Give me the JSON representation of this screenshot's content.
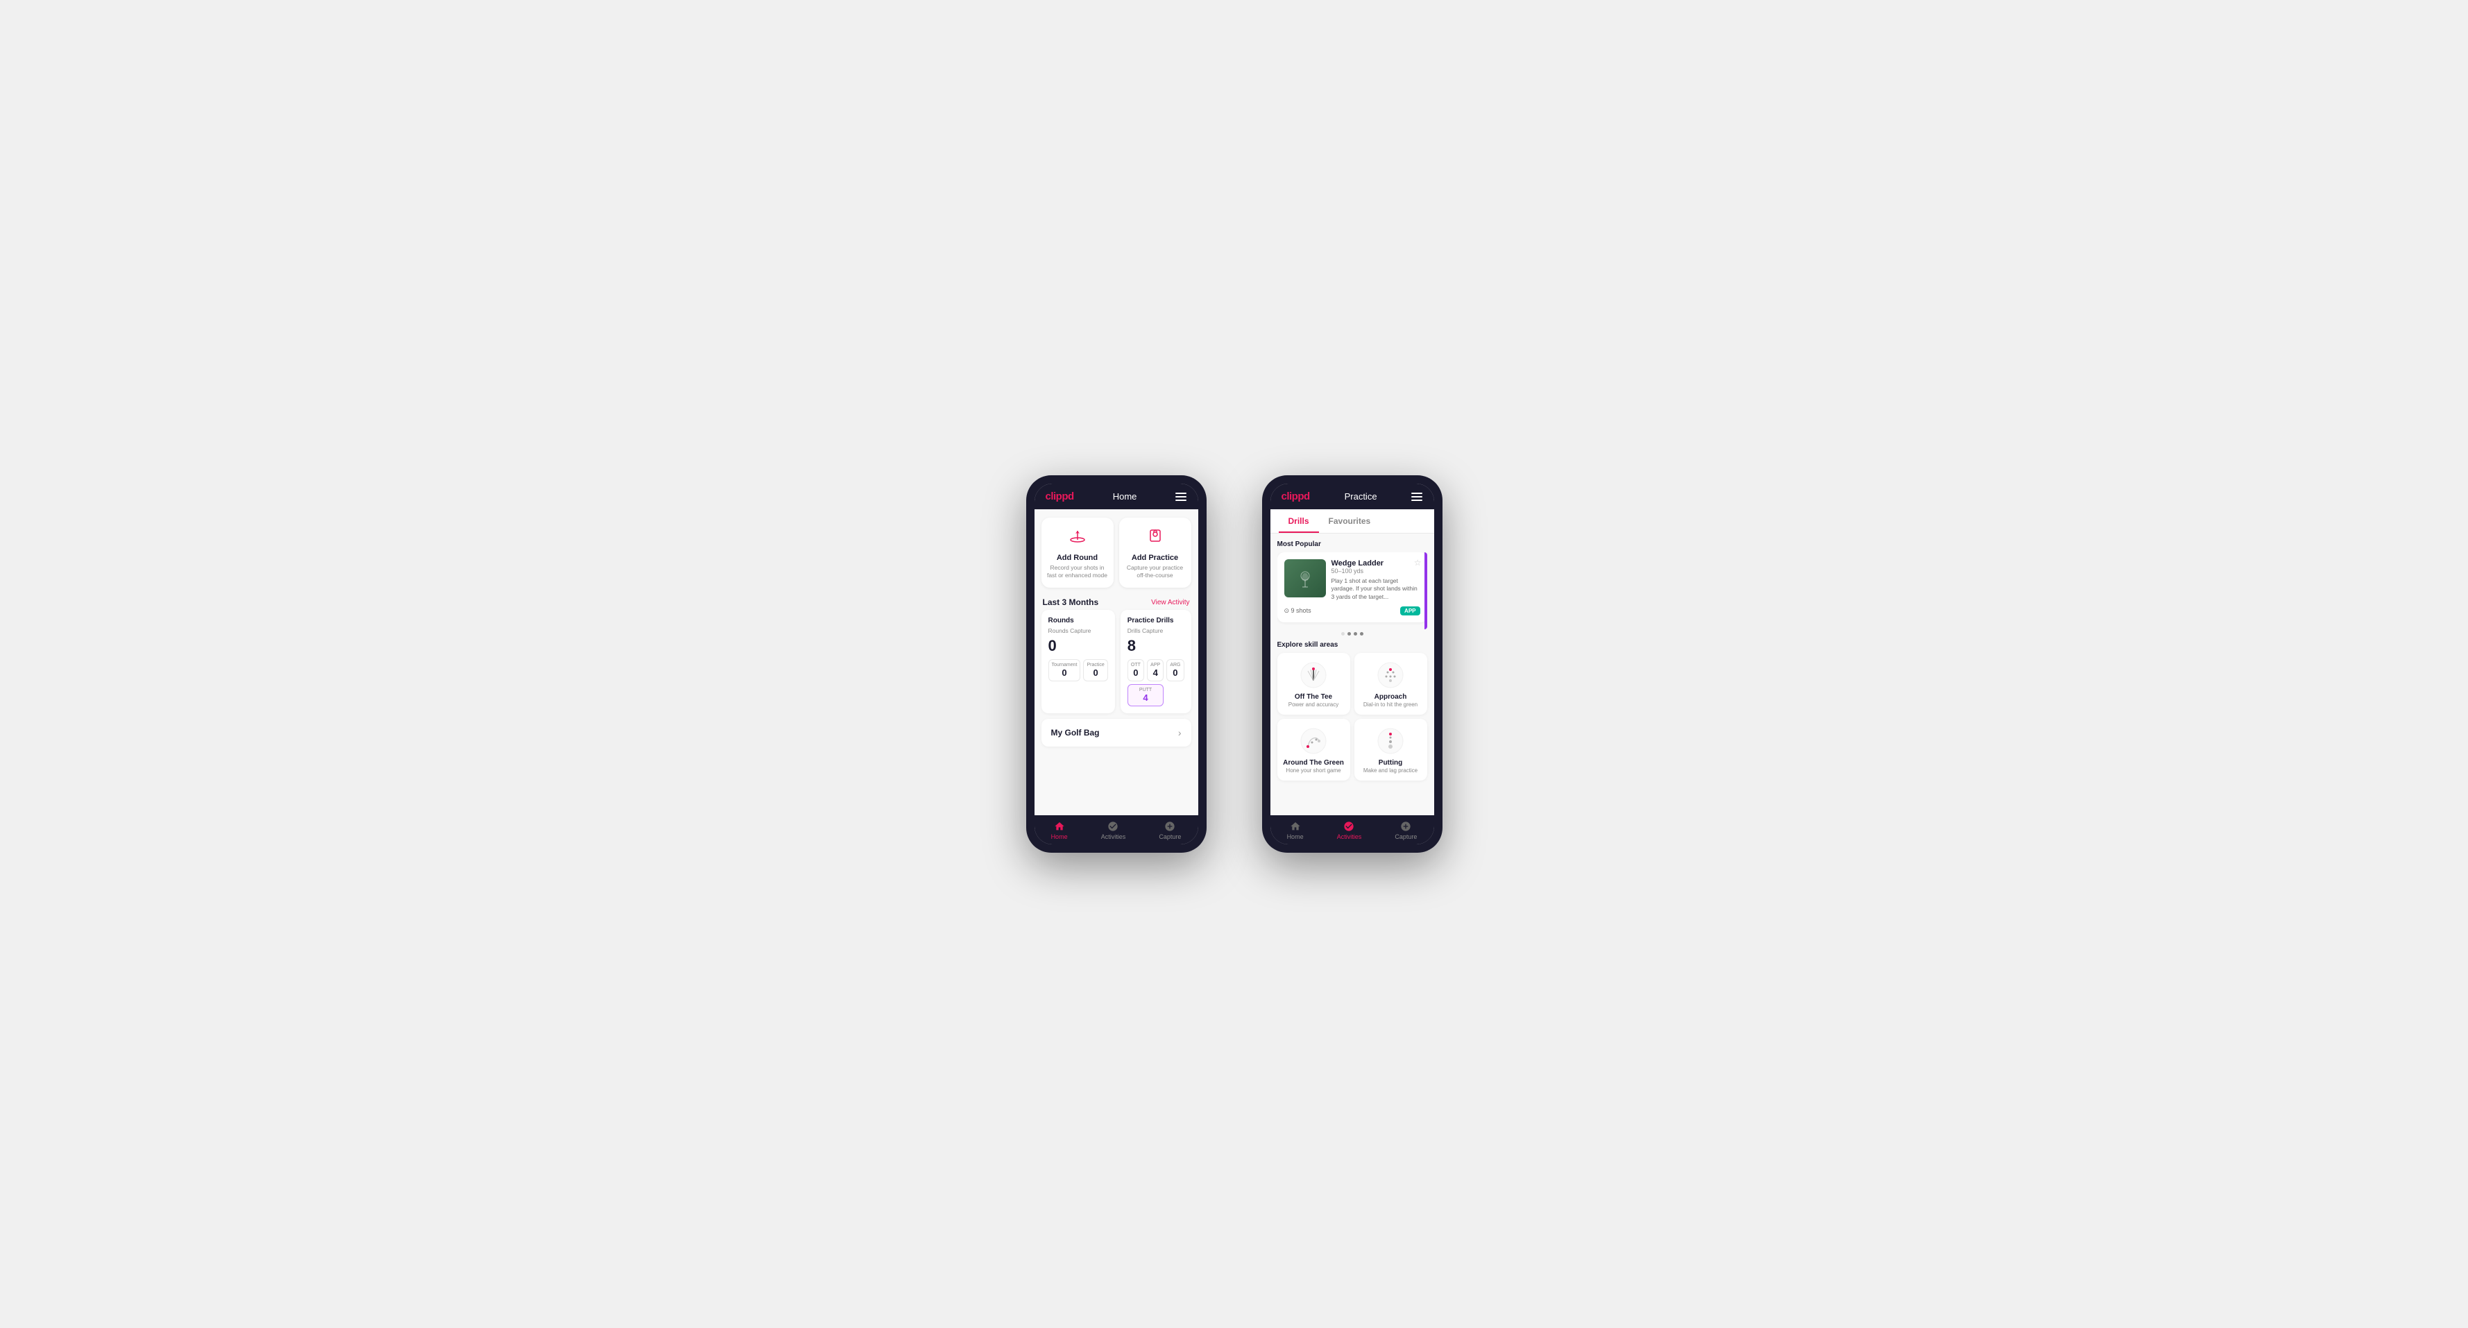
{
  "phone1": {
    "logo": "clippd",
    "title": "Home",
    "cards": [
      {
        "id": "add-round",
        "icon": "⛳",
        "title": "Add Round",
        "subtitle": "Record your shots in fast or enhanced mode"
      },
      {
        "id": "add-practice",
        "icon": "📋",
        "title": "Add Practice",
        "subtitle": "Capture your practice off-the-course"
      }
    ],
    "stats_section": {
      "label": "Last 3 Months",
      "link": "View Activity"
    },
    "rounds": {
      "title": "Rounds",
      "capture_label": "Rounds Capture",
      "total": "0",
      "tournament_label": "Tournament",
      "tournament": "0",
      "practice_label": "Practice",
      "practice": "0"
    },
    "drills": {
      "title": "Practice Drills",
      "capture_label": "Drills Capture",
      "total": "8",
      "ott_label": "OTT",
      "ott": "0",
      "app_label": "APP",
      "app": "4",
      "arg_label": "ARG",
      "arg": "0",
      "putt_label": "PUTT",
      "putt": "4"
    },
    "golf_bag": "My Golf Bag",
    "nav": [
      {
        "label": "Home",
        "icon": "🏠",
        "active": true
      },
      {
        "label": "Activities",
        "icon": "⚙",
        "active": false
      },
      {
        "label": "Capture",
        "icon": "➕",
        "active": false
      }
    ]
  },
  "phone2": {
    "logo": "clippd",
    "title": "Practice",
    "tabs": [
      {
        "label": "Drills",
        "active": true
      },
      {
        "label": "Favourites",
        "active": false
      }
    ],
    "most_popular_label": "Most Popular",
    "featured_drill": {
      "title": "Wedge Ladder",
      "yardage": "50–100 yds",
      "description": "Play 1 shot at each target yardage. If your shot lands within 3 yards of the target...",
      "shots": "9 shots",
      "badge": "APP"
    },
    "dots": [
      false,
      true,
      true,
      true
    ],
    "explore_label": "Explore skill areas",
    "skills": [
      {
        "title": "Off The Tee",
        "subtitle": "Power and accuracy",
        "icon": "tee"
      },
      {
        "title": "Approach",
        "subtitle": "Dial-in to hit the green",
        "icon": "approach"
      },
      {
        "title": "Around The Green",
        "subtitle": "Hone your short game",
        "icon": "short"
      },
      {
        "title": "Putting",
        "subtitle": "Make and lag practice",
        "icon": "putt"
      }
    ],
    "nav": [
      {
        "label": "Home",
        "icon": "🏠",
        "active": false
      },
      {
        "label": "Activities",
        "icon": "⚙",
        "active": true
      },
      {
        "label": "Capture",
        "icon": "➕",
        "active": false
      }
    ]
  }
}
